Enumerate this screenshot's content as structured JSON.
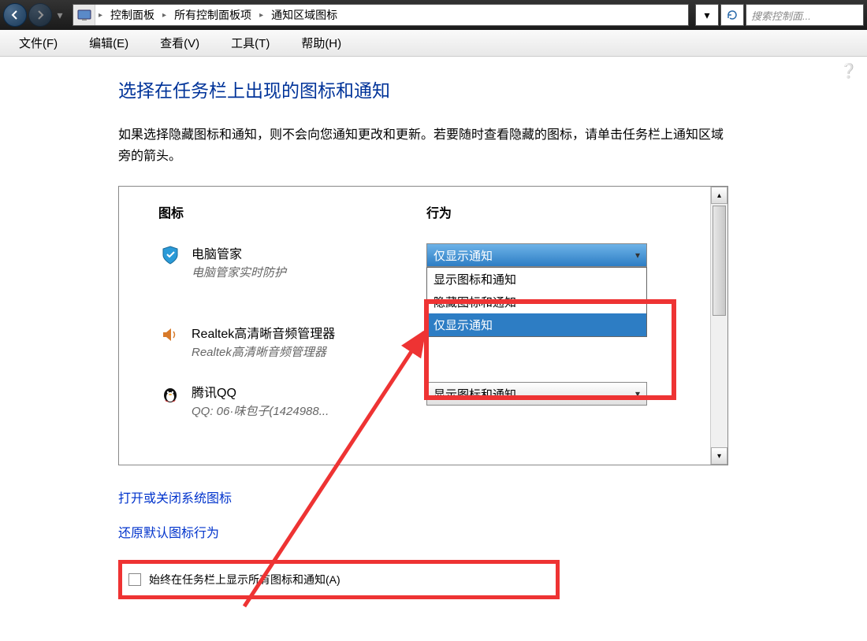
{
  "nav": {
    "breadcrumbs": [
      "控制面板",
      "所有控制面板项",
      "通知区域图标"
    ],
    "search_placeholder": "搜索控制面..."
  },
  "menu": {
    "file": "文件(F)",
    "edit": "编辑(E)",
    "view": "查看(V)",
    "tools": "工具(T)",
    "help": "帮助(H)"
  },
  "page": {
    "title": "选择在任务栏上出现的图标和通知",
    "desc": "如果选择隐藏图标和通知，则不会向您通知更改和更新。若要随时查看隐藏的图标，请单击任务栏上通知区域旁的箭头。"
  },
  "columns": {
    "icon": "图标",
    "behavior": "行为"
  },
  "rows": [
    {
      "name": "电脑管家",
      "sub": "电脑管家实时防护",
      "selected": "仅显示通知"
    },
    {
      "name": "Realtek高清晰音频管理器",
      "sub": "Realtek高清晰音频管理器",
      "selected": ""
    },
    {
      "name": "腾讯QQ",
      "sub": "QQ: 06·味包子(1424988...",
      "selected": "显示图标和通知"
    }
  ],
  "dropdown": {
    "options": [
      "显示图标和通知",
      "隐藏图标和通知",
      "仅显示通知"
    ],
    "selected_index": 2
  },
  "links": {
    "system_icons": "打开或关闭系统图标",
    "restore_defaults": "还原默认图标行为"
  },
  "checkbox": {
    "label": "始终在任务栏上显示所有图标和通知(A)"
  }
}
